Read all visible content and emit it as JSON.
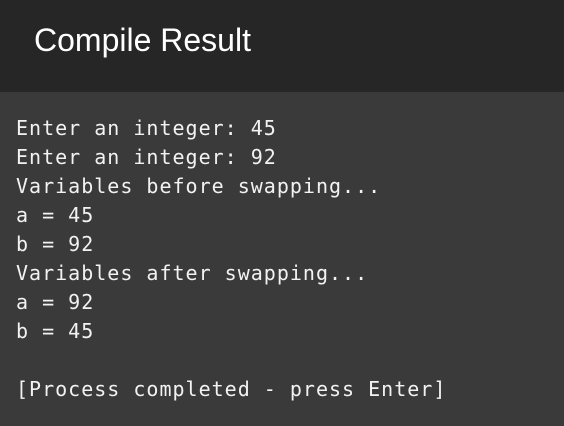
{
  "window": {
    "title": "Compile Result"
  },
  "console": {
    "lines": [
      "Enter an integer: 45",
      "Enter an integer: 92",
      "Variables before swapping...",
      "a = 45",
      "b = 92",
      "Variables after swapping...",
      "a = 92",
      "b = 45",
      "",
      "[Process completed - press Enter]"
    ]
  },
  "colors": {
    "titlebar_bg": "#262626",
    "console_bg": "#3a3a3a",
    "text": "#f2f2f2"
  }
}
